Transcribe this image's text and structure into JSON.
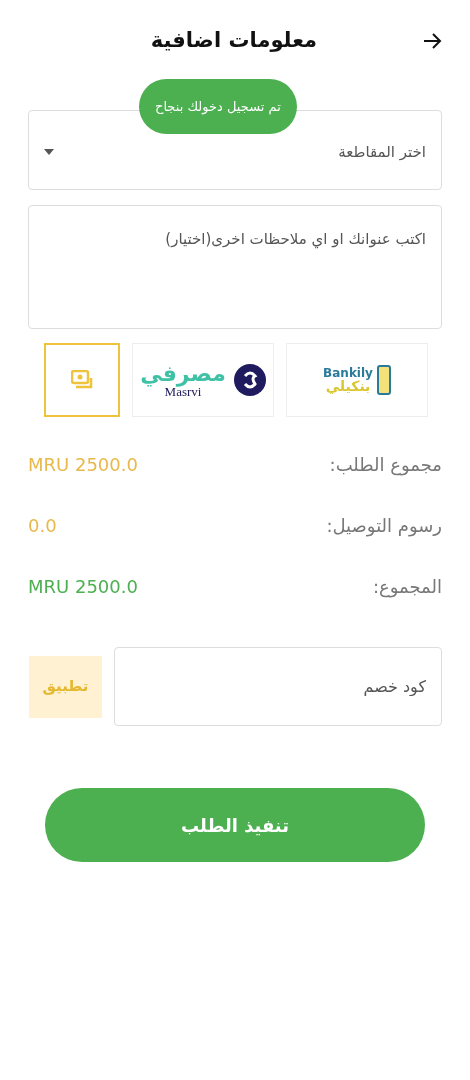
{
  "header": {
    "title": "معلومات اضافية"
  },
  "toast": {
    "text": "تم تسجيل دخولك بنجاح"
  },
  "area_select": {
    "placeholder": "اختر المقاطعة"
  },
  "notes_field": {
    "placeholder": "اكتب عنوانك او اي ملاحظات اخرى(اختيار)"
  },
  "payment_methods": [
    {
      "kind": "bankily",
      "texts": [
        "Bankily",
        "بنكيلي"
      ],
      "selected": false
    },
    {
      "kind": "masrvi",
      "texts": [
        "مصرفي",
        "Masrvi"
      ],
      "selected": false
    },
    {
      "kind": "cash",
      "selected": true
    }
  ],
  "summary": [
    {
      "label": "مجموع الطلب:",
      "value": "MRU 2500.0",
      "color": "#e8b94a"
    },
    {
      "label": "رسوم التوصيل:",
      "value": "0.0",
      "color": "#e8b94a"
    },
    {
      "label": "المجموع:",
      "value": "MRU 2500.0",
      "color": "#4caf50"
    }
  ],
  "discount": {
    "placeholder": "كود خصم",
    "apply_label": "تطبيق"
  },
  "submit_button": {
    "label": "تنفيذ الطلب"
  }
}
